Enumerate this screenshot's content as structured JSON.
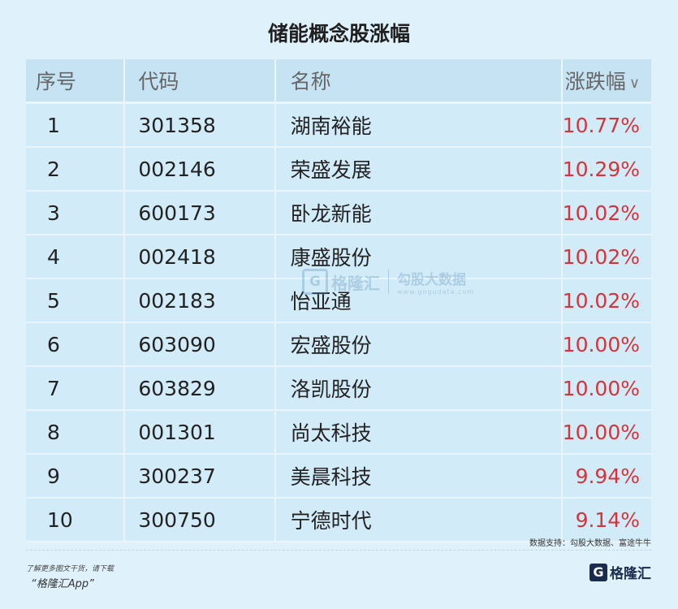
{
  "title": "储能概念股涨幅",
  "headers": {
    "no": "序号",
    "code": "代码",
    "name": "名称",
    "pct": "涨跌幅"
  },
  "rows": [
    {
      "no": "1",
      "code": "301358",
      "name": "湖南裕能",
      "pct": "10.77%"
    },
    {
      "no": "2",
      "code": "002146",
      "name": "荣盛发展",
      "pct": "10.29%"
    },
    {
      "no": "3",
      "code": "600173",
      "name": "卧龙新能",
      "pct": "10.02%"
    },
    {
      "no": "4",
      "code": "002418",
      "name": "康盛股份",
      "pct": "10.02%"
    },
    {
      "no": "5",
      "code": "002183",
      "name": "怡亚通",
      "pct": "10.02%"
    },
    {
      "no": "6",
      "code": "603090",
      "name": "宏盛股份",
      "pct": "10.00%"
    },
    {
      "no": "7",
      "code": "603829",
      "name": "洛凯股份",
      "pct": "10.00%"
    },
    {
      "no": "8",
      "code": "001301",
      "name": "尚太科技",
      "pct": "10.00%"
    },
    {
      "no": "9",
      "code": "300237",
      "name": "美晨科技",
      "pct": "9.94%"
    },
    {
      "no": "10",
      "code": "300750",
      "name": "宁德时代",
      "pct": "9.14%"
    }
  ],
  "source": "数据支持：勾股大数据、富途牛牛",
  "promo": {
    "line1": "了解更多图文干货，请下载",
    "line2": "“格隆汇App”"
  },
  "logo": {
    "mark": "G",
    "text": "格隆汇"
  },
  "watermark": {
    "mark": "G",
    "brand": "格隆汇",
    "sub": "勾股大数据",
    "url": "www.gogudata.com"
  },
  "colors": {
    "positive": "#d4343a",
    "background": "#dff1fb",
    "header": "#c6e3f4"
  }
}
